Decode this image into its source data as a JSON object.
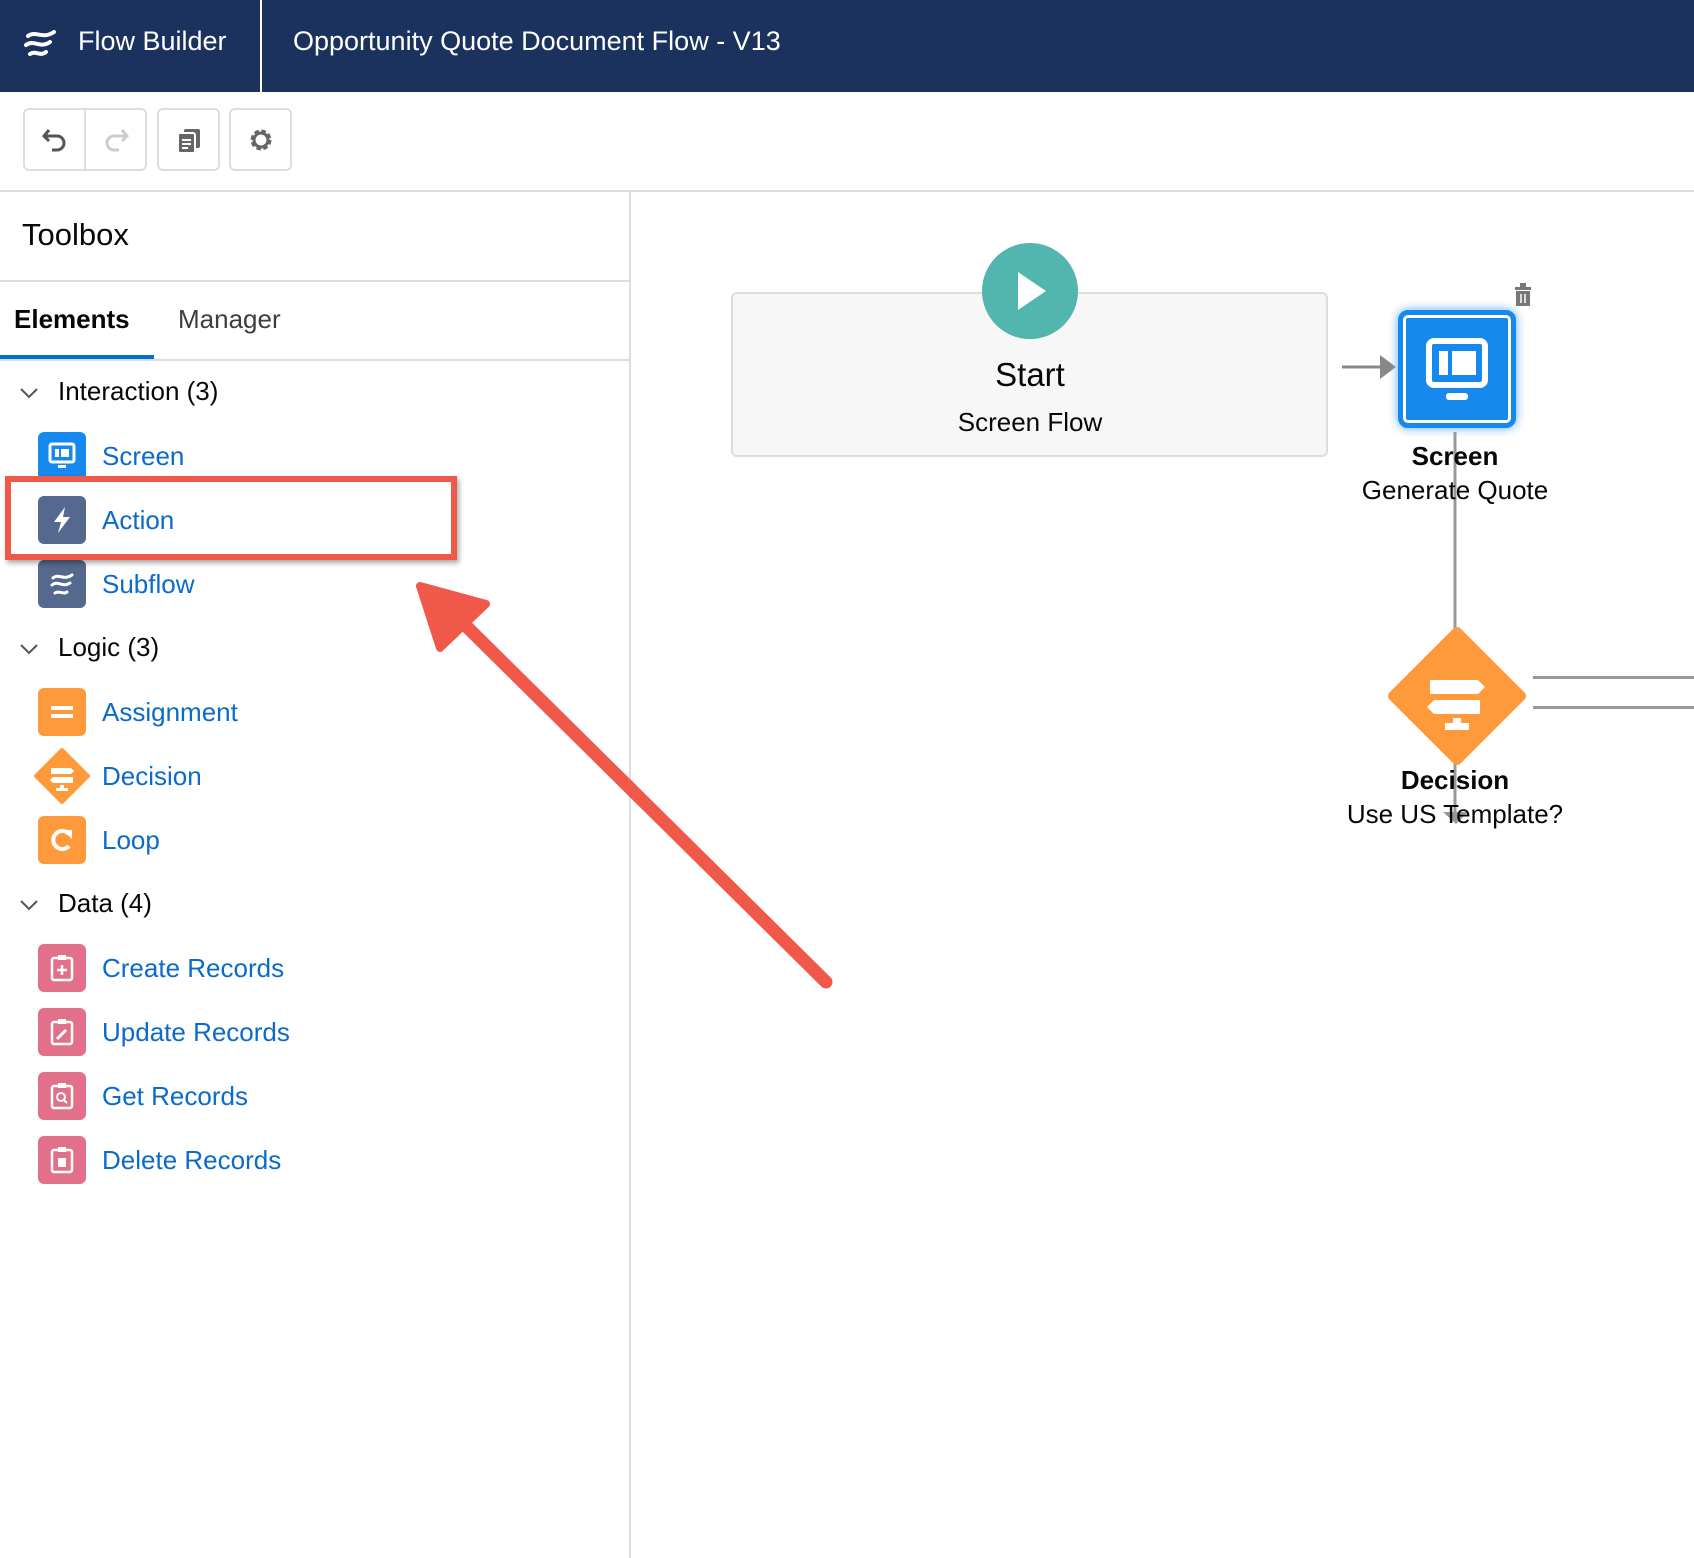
{
  "header": {
    "app_name": "Flow Builder",
    "flow_title": "Opportunity Quote Document Flow - V13"
  },
  "toolbar": {
    "buttons": [
      {
        "icon": "undo-icon",
        "enabled": true
      },
      {
        "icon": "redo-icon",
        "enabled": false
      },
      {
        "icon": "copy-icon",
        "enabled": true
      },
      {
        "icon": "gear-icon",
        "enabled": true
      }
    ]
  },
  "toolbox": {
    "title": "Toolbox",
    "tabs": [
      {
        "label": "Elements",
        "active": true
      },
      {
        "label": "Manager",
        "active": false
      }
    ],
    "sections": [
      {
        "label": "Interaction (3)",
        "items": [
          {
            "label": "Screen",
            "icon": "screen-icon",
            "color": "#1589ee"
          },
          {
            "label": "Action",
            "icon": "lightning-icon",
            "color": "#54698d",
            "highlighted": true
          },
          {
            "label": "Subflow",
            "icon": "flow-icon",
            "color": "#54698d"
          }
        ]
      },
      {
        "label": "Logic (3)",
        "items": [
          {
            "label": "Assignment",
            "icon": "assignment-icon",
            "color": "#ff9a3c"
          },
          {
            "label": "Decision",
            "icon": "decision-icon",
            "color": "#ff9a3c"
          },
          {
            "label": "Loop",
            "icon": "loop-icon",
            "color": "#ff9a3c"
          }
        ]
      },
      {
        "label": "Data (4)",
        "items": [
          {
            "label": "Create Records",
            "icon": "record-create-icon",
            "color": "#e3708b"
          },
          {
            "label": "Update Records",
            "icon": "record-update-icon",
            "color": "#e3708b"
          },
          {
            "label": "Get Records",
            "icon": "record-lookup-icon",
            "color": "#e3708b"
          },
          {
            "label": "Delete Records",
            "icon": "record-delete-icon",
            "color": "#e3708b"
          }
        ]
      }
    ]
  },
  "canvas": {
    "start": {
      "title": "Start",
      "subtitle": "Screen Flow"
    },
    "screen_node": {
      "type": "Screen",
      "label": "Generate Quote"
    },
    "decision_node": {
      "type": "Decision",
      "label": "Use US Template?"
    }
  },
  "annotation": {
    "color": "#f0584a"
  }
}
